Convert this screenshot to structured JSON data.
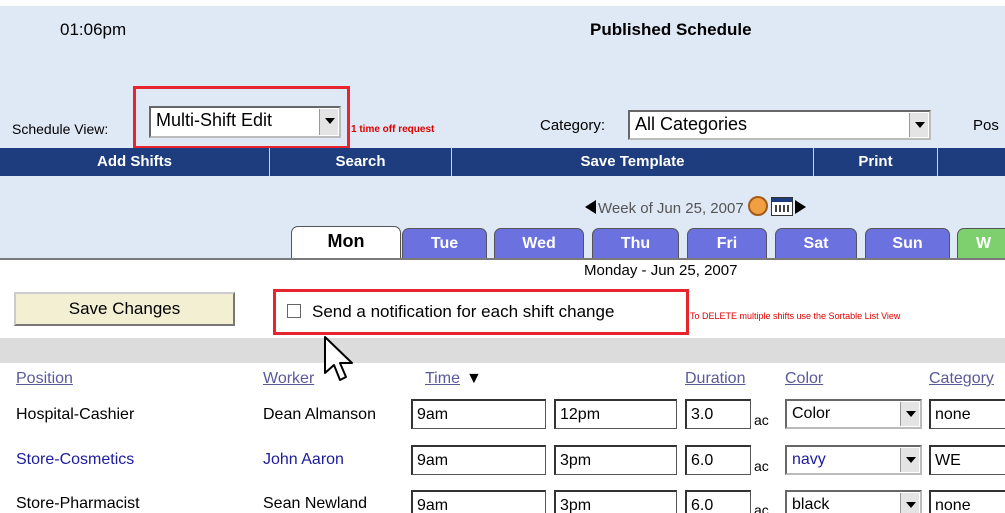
{
  "header": {
    "time": "01:06pm",
    "title": "Published Schedule"
  },
  "controls": {
    "schedule_view_label": "Schedule View:",
    "schedule_view_value": "Multi-Shift Edit",
    "time_off_text": "1 time off request",
    "category_label": "Category:",
    "category_value": "All Categories",
    "position_label": "Pos"
  },
  "menu": [
    "Add Shifts",
    "Search",
    "Save Template",
    "Print"
  ],
  "week": {
    "label": "Week of Jun 25, 2007"
  },
  "tabs": [
    "Mon",
    "Tue",
    "Wed",
    "Thu",
    "Fri",
    "Sat",
    "Sun",
    "W"
  ],
  "day_title": "Monday - Jun 25, 2007",
  "save_button": "Save Changes",
  "notify_label": "Send a notification for each shift change",
  "delete_note": "To DELETE multiple shifts use the Sortable List View",
  "table": {
    "headers": {
      "position": "Position",
      "worker": "Worker",
      "time": "Time",
      "duration": "Duration",
      "color": "Color",
      "category": "Category"
    },
    "unit_label": "ac",
    "rows": [
      {
        "position": "Hospital-Cashier",
        "worker": "Dean Almanson",
        "start": "9am",
        "end": "12pm",
        "duration": "3.0",
        "color": "Color",
        "category": "none"
      },
      {
        "position": "Store-Cosmetics",
        "worker": "John Aaron",
        "start": "9am",
        "end": "3pm",
        "duration": "6.0",
        "color": "navy",
        "category": "WE"
      },
      {
        "position": "Store-Pharmacist",
        "worker": "Sean Newland",
        "start": "9am",
        "end": "3pm",
        "duration": "6.0",
        "color": "black",
        "category": "none"
      }
    ]
  },
  "colors": {
    "menubar": "#1d3d7e",
    "tab": "#6b72e0",
    "highlight": "#e8252f",
    "link": "#1c1c9c"
  }
}
